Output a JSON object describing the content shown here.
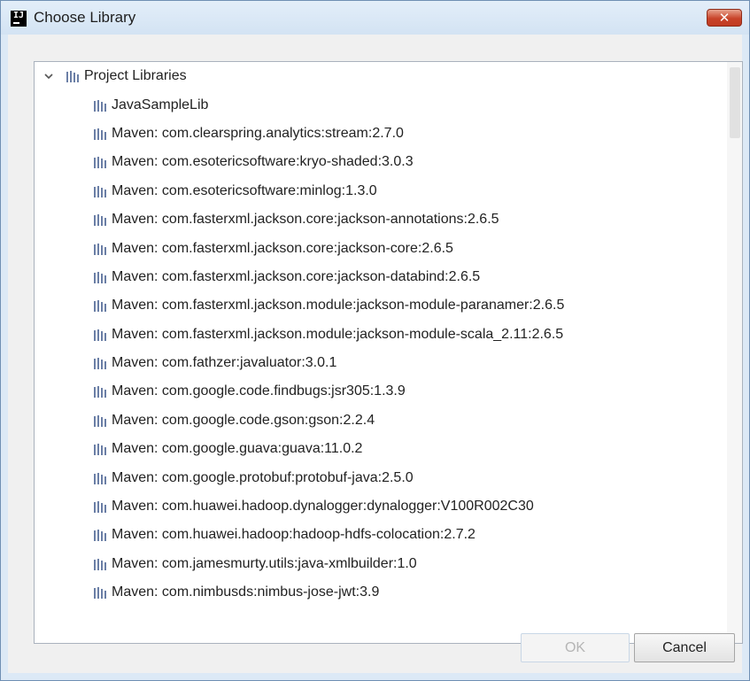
{
  "window": {
    "title": "Choose Library",
    "app_icon_text": "IJ",
    "close_glyph": "✕"
  },
  "tree": {
    "root": {
      "label": "Project Libraries",
      "expanded": true,
      "icon": "library-icon",
      "chevron_icon": "chevron-down-icon"
    },
    "items": [
      "JavaSampleLib",
      "Maven: com.clearspring.analytics:stream:2.7.0",
      "Maven: com.esotericsoftware:kryo-shaded:3.0.3",
      "Maven: com.esotericsoftware:minlog:1.3.0",
      "Maven: com.fasterxml.jackson.core:jackson-annotations:2.6.5",
      "Maven: com.fasterxml.jackson.core:jackson-core:2.6.5",
      "Maven: com.fasterxml.jackson.core:jackson-databind:2.6.5",
      "Maven: com.fasterxml.jackson.module:jackson-module-paranamer:2.6.5",
      "Maven: com.fasterxml.jackson.module:jackson-module-scala_2.11:2.6.5",
      "Maven: com.fathzer:javaluator:3.0.1",
      "Maven: com.google.code.findbugs:jsr305:1.3.9",
      "Maven: com.google.code.gson:gson:2.2.4",
      "Maven: com.google.guava:guava:11.0.2",
      "Maven: com.google.protobuf:protobuf-java:2.5.0",
      "Maven: com.huawei.hadoop.dynalogger:dynalogger:V100R002C30",
      "Maven: com.huawei.hadoop:hadoop-hdfs-colocation:2.7.2",
      "Maven: com.jamesmurty.utils:java-xmlbuilder:1.0",
      "Maven: com.nimbusds:nimbus-jose-jwt:3.9"
    ]
  },
  "buttons": {
    "ok_label": "OK",
    "ok_enabled": false,
    "cancel_label": "Cancel"
  },
  "colors": {
    "library_icon": "#5a6e93",
    "close_button": "#c8442a",
    "titlebar": "#dce9f6"
  }
}
